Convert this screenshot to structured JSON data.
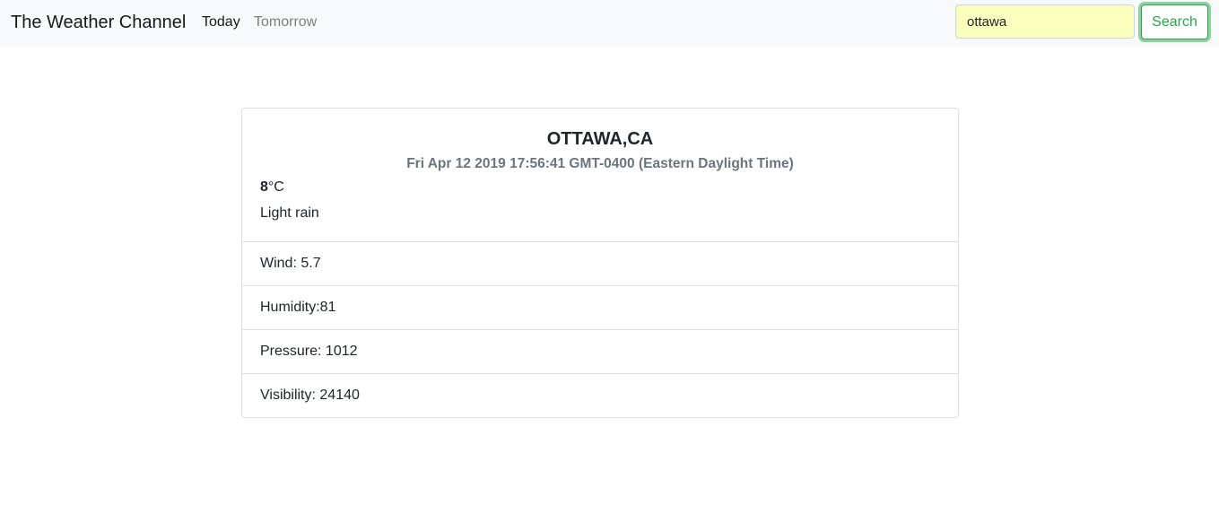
{
  "navbar": {
    "brand": "The Weather Channel",
    "links": {
      "today": "Today",
      "tomorrow": "Tomorrow"
    },
    "search": {
      "value": "ottawa",
      "button_label": "Search"
    }
  },
  "weather": {
    "city": "OTTAWA,CA",
    "datetime": "Fri Apr 12 2019 17:56:41 GMT-0400 (Eastern Daylight Time)",
    "temperature": "8",
    "temperature_unit": "°C",
    "condition": "Light rain",
    "details": {
      "wind": "Wind: 5.7",
      "humidity": "Humidity:81",
      "pressure": "Pressure: 1012",
      "visibility": "Visibility: 24140"
    }
  },
  "colors": {
    "navbar_bg": "#f8f9fa",
    "autofill_bg": "#faffbd",
    "success": "#28a745",
    "muted": "#6c757d"
  }
}
